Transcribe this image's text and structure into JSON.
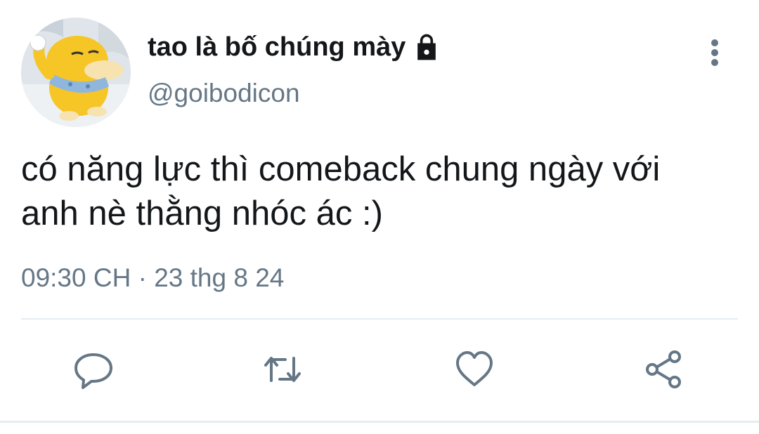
{
  "tweet": {
    "display_name": "tao là bố chúng mày",
    "handle": "@goibodicon",
    "text_line1": "có năng lực thì comeback chung ngày với",
    "text_line2": "anh nè thằng nhóc ác :)",
    "time": "09:30 CH",
    "separator": " · ",
    "date": "23 thg 8 24",
    "account_locked_icon": "lock-icon",
    "more_menu_icon": "more-vertical-icon"
  },
  "actions": {
    "reply_icon": "reply-icon",
    "retweet_icon": "retweet-icon",
    "like_icon": "heart-icon",
    "share_icon": "share-icon"
  },
  "colors": {
    "text": "#14171a",
    "secondary_text": "#657786",
    "divider": "#e6ecf0",
    "avatar_character": "#f6c526"
  }
}
